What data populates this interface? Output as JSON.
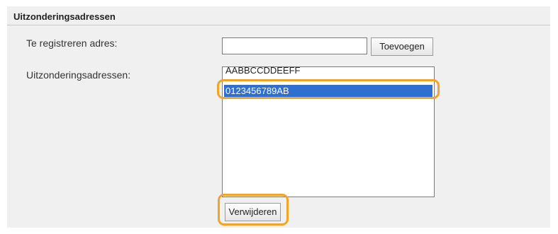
{
  "section": {
    "title": "Uitzonderingsadressen"
  },
  "register": {
    "label": "Te registreren adres:",
    "input_value": "",
    "add_button": "Toevoegen"
  },
  "exceptions": {
    "label": "Uitzonderingsadressen:",
    "items": [
      {
        "text": "AABBCCDDEEFF"
      },
      {
        "text": "0123456789AB",
        "selected": true
      }
    ],
    "delete_button": "Verwijderen"
  },
  "colors": {
    "panel_bg": "#f0f0f0",
    "selection": "#2f6fd0",
    "highlight": "#f2a427"
  }
}
